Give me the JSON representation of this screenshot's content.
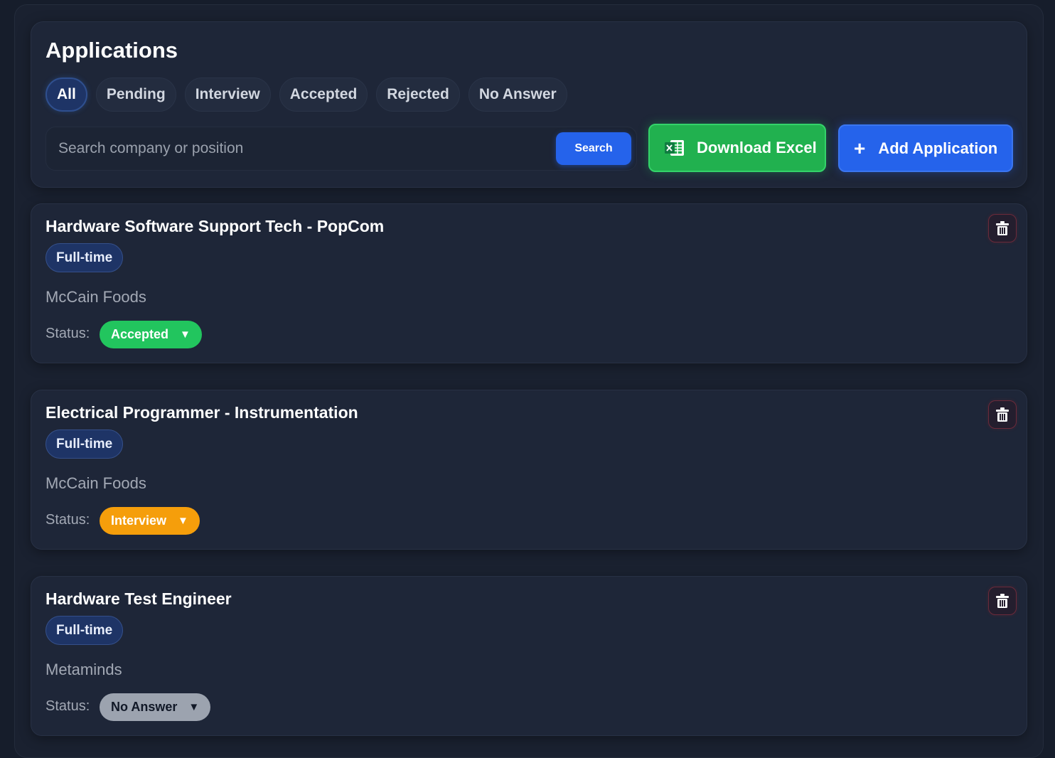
{
  "page": {
    "title": "Applications",
    "filters": [
      "All",
      "Pending",
      "Interview",
      "Accepted",
      "Rejected",
      "No Answer"
    ],
    "active_filter": "All"
  },
  "search": {
    "placeholder": "Search company or position",
    "value": "",
    "button_label": "Search"
  },
  "actions": {
    "download_label": "Download Excel",
    "add_label": "Add Application",
    "add_icon": "+"
  },
  "status_label": "Status:",
  "applications": [
    {
      "title": "Hardware Software Support Tech - PopCom",
      "type": "Full-time",
      "company": "McCain Foods",
      "status": "Accepted",
      "status_color": "#22c55e"
    },
    {
      "title": "Electrical Programmer - Instrumentation",
      "type": "Full-time",
      "company": "McCain Foods",
      "status": "Interview",
      "status_color": "#f59e0b"
    },
    {
      "title": "Hardware Test Engineer",
      "type": "Full-time",
      "company": "Metaminds",
      "status": "No Answer",
      "status_color": "#9ca3af"
    }
  ],
  "dropdown_arrow": "▼",
  "colors": {
    "background": "#161d2b",
    "panel": "#1e2638",
    "accent_blue": "#2563eb",
    "excel_green": "#21b14f",
    "delete_border": "#6b2a3a"
  },
  "icons": {
    "excel": "excel-icon",
    "delete": "trash-icon",
    "add": "plus-icon",
    "dropdown": "chevron-down-icon"
  }
}
